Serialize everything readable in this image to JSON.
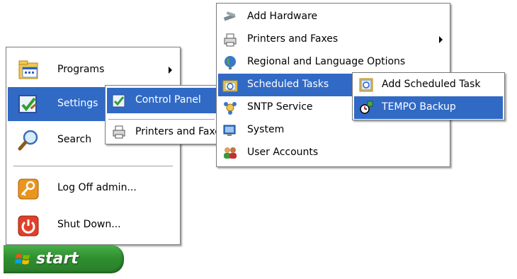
{
  "start_menu": {
    "items": [
      {
        "label": "Programs",
        "icon": "programs-icon"
      },
      {
        "label": "Settings",
        "icon": "settings-icon"
      },
      {
        "label": "Search",
        "icon": "search-icon"
      },
      {
        "label": "Log Off admin...",
        "icon": "log-off-icon"
      },
      {
        "label": "Shut Down...",
        "icon": "shut-down-icon"
      }
    ],
    "start_label": "start"
  },
  "settings_menu": {
    "items": [
      {
        "label": "Control Panel",
        "icon": "control-panel-icon"
      },
      {
        "label": "Printers and Faxes",
        "icon": "printers-icon"
      }
    ]
  },
  "control_panel_menu": {
    "items": [
      {
        "label": "Add Hardware",
        "icon": "add-hardware-icon"
      },
      {
        "label": "Printers and Faxes",
        "icon": "printers-icon"
      },
      {
        "label": "Regional and Language Options",
        "icon": "globe-icon"
      },
      {
        "label": "Scheduled Tasks",
        "icon": "scheduled-tasks-icon"
      },
      {
        "label": "SNTP Service",
        "icon": "sntp-service-icon"
      },
      {
        "label": "System",
        "icon": "system-icon"
      },
      {
        "label": "User Accounts",
        "icon": "user-accounts-icon"
      }
    ]
  },
  "scheduled_tasks_menu": {
    "items": [
      {
        "label": "Add Scheduled Task",
        "icon": "add-task-icon"
      },
      {
        "label": "TEMPO Backup",
        "icon": "task-icon"
      }
    ]
  },
  "colors": {
    "selection": "#316ac5",
    "start_button": "#2f8f2f"
  }
}
